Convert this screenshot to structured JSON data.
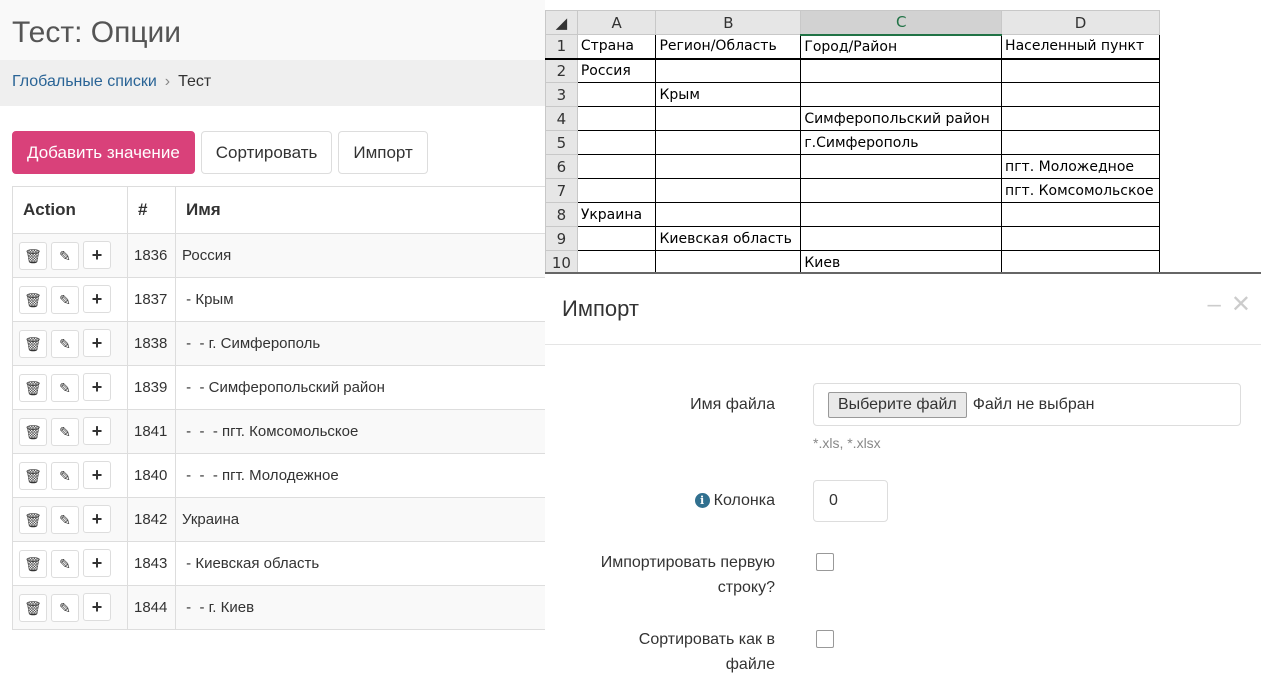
{
  "page": {
    "title": "Тест: Опции",
    "breadcrumb": [
      "Глобальные списки",
      "Тест"
    ]
  },
  "toolbar": {
    "add": "Добавить значение",
    "sort": "Сортировать",
    "import": "Импорт"
  },
  "table": {
    "headers": [
      "Action",
      "#",
      "Имя"
    ],
    "rows": [
      {
        "id": "1836",
        "name": "Россия"
      },
      {
        "id": "1837",
        "name": " - Крым"
      },
      {
        "id": "1838",
        "name": " -  - г. Симферополь"
      },
      {
        "id": "1839",
        "name": " -  - Симферопольский район"
      },
      {
        "id": "1841",
        "name": " -  -  - пгт. Комсомольское"
      },
      {
        "id": "1840",
        "name": " -  -  - пгт. Молодежное"
      },
      {
        "id": "1842",
        "name": "Украина"
      },
      {
        "id": "1843",
        "name": " - Киевская область"
      },
      {
        "id": "1844",
        "name": " -  - г. Киев"
      }
    ]
  },
  "sheet": {
    "columns": [
      "A",
      "B",
      "C",
      "D"
    ],
    "selected_column": "C",
    "rows": [
      [
        "1",
        "Страна",
        "Регион/Область",
        "Город/Район",
        "Населенный пункт"
      ],
      [
        "2",
        "Россия",
        "",
        "",
        ""
      ],
      [
        "3",
        "",
        "Крым",
        "",
        ""
      ],
      [
        "4",
        "",
        "",
        "Симферопольский район",
        ""
      ],
      [
        "5",
        "",
        "",
        "г.Симферополь",
        ""
      ],
      [
        "6",
        "",
        "",
        "",
        "пгт. Моложедное"
      ],
      [
        "7",
        "",
        "",
        "",
        "пгт. Комсомольское"
      ],
      [
        "8",
        "Украина",
        "",
        "",
        ""
      ],
      [
        "9",
        "",
        "Киевская область",
        "",
        ""
      ],
      [
        "10",
        "",
        "",
        "Киев",
        ""
      ]
    ]
  },
  "dialog": {
    "title": "Импорт",
    "file_label": "Имя файла",
    "file_button": "Выберите файл",
    "file_status": "Файл не выбран",
    "file_hint": "*.xls, *.xlsx",
    "column_label": "Колонка",
    "column_value": "0",
    "first_row_label": "Импортировать первую строку?",
    "first_row_checked": false,
    "sort_label": "Сортировать как в файле",
    "sort_checked": false
  },
  "colors": {
    "primary": "#d9417a",
    "link": "#2a6496",
    "excel_accent": "#217346"
  }
}
